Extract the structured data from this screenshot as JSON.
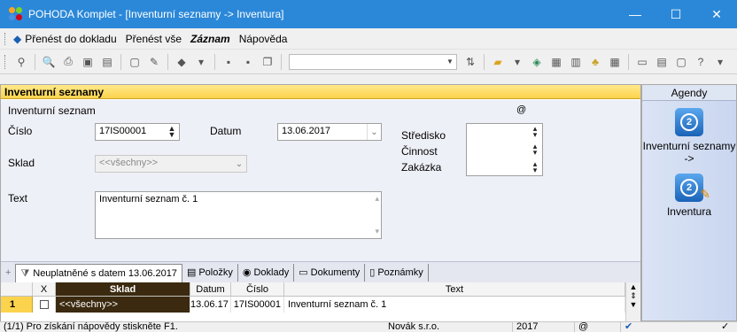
{
  "window": {
    "title": "POHODA Komplet - [Inventurní seznamy -> Inventura]",
    "minimize": "—",
    "maximize": "☐",
    "close": "✕"
  },
  "menu": {
    "items": [
      "Přenést do dokladu",
      "Přenést vše",
      "Záznam",
      "Nápověda"
    ]
  },
  "section": {
    "title": "Inventurní seznamy"
  },
  "form": {
    "group_label": "Inventurní seznam",
    "at_symbol": "@",
    "cislo_label": "Číslo",
    "cislo_value": "17IS00001",
    "datum_label": "Datum",
    "datum_value": "13.06.2017",
    "sklad_label": "Sklad",
    "sklad_value": "<<všechny>>",
    "text_label": "Text",
    "text_value": "Inventurní seznam č. 1",
    "stredisko_label": "Středisko",
    "cinnost_label": "Činnost",
    "zakazka_label": "Zakázka"
  },
  "tabs": [
    {
      "label": "Neuplatněné s datem 13.06.2017"
    },
    {
      "label": "Položky"
    },
    {
      "label": "Doklady"
    },
    {
      "label": "Dokumenty"
    },
    {
      "label": "Poznámky"
    }
  ],
  "grid": {
    "headers": [
      "X",
      "Sklad",
      "Datum",
      "Číslo",
      "Text"
    ],
    "rows": [
      {
        "num": "1",
        "x": "",
        "sklad": "<<všechny>>",
        "datum": "13.06.17",
        "cislo": "17IS00001",
        "text": "Inventurní seznam č. 1"
      }
    ]
  },
  "agendy": {
    "title": "Agendy",
    "items": [
      {
        "label": "Inventurní seznamy ->"
      },
      {
        "label": "Inventura"
      }
    ]
  },
  "status": {
    "help": "(1/1) Pro získání nápovědy stiskněte F1.",
    "company": "Novák s.r.o.",
    "year": "2017",
    "at": "@"
  },
  "colors": {
    "titlebar": "#2b88d8",
    "section_header": "#fcd34d",
    "grid_header_active": "#3b2a0f"
  }
}
